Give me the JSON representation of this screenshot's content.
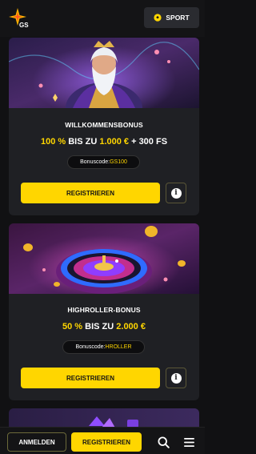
{
  "header": {
    "logo_icon": "gs-star-logo",
    "logo_text": "GS",
    "sport_label": "SPORT",
    "sport_icon": "soccer-ball-icon"
  },
  "cards": [
    {
      "title": "WILLKOMMENSBONUS",
      "offer": {
        "pct": "100 %",
        "mid": " BIS ZU ",
        "amount": "1.000 €",
        "extra": " + 300 FS"
      },
      "code_label": "Bonuscode: ",
      "code": "GS100",
      "register_label": "REGISTRIEREN",
      "info_icon": "info-icon"
    },
    {
      "title": "HIGHROLLER-BONUS",
      "offer": {
        "pct": "50 %",
        "mid": " BIS ZU ",
        "amount": "2.000 €"
      },
      "code_label": "Bonuscode: ",
      "code": "HROLLER",
      "register_label": "REGISTRIEREN",
      "info_icon": "info-icon"
    }
  ],
  "bottom_bar": {
    "login_label": "ANMELDEN",
    "register_label": "REGISTRIEREN",
    "search_icon": "search-icon",
    "menu_icon": "hamburger-menu-icon"
  },
  "colors": {
    "accent": "#ffd600",
    "background": "#111113",
    "card": "#1f2024"
  }
}
